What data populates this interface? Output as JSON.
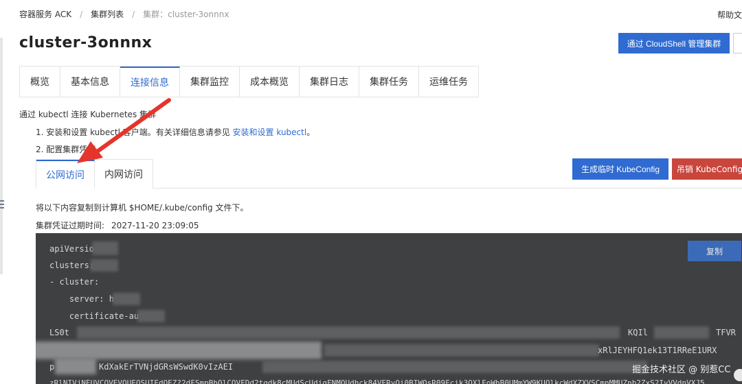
{
  "breadcrumb": [
    "容器服务 ACK",
    "集群列表",
    "集群：cluster-3onnnx"
  ],
  "help_label": "帮助文",
  "page_title": "cluster-3onnnx",
  "cloudshell_button": "通过 CloudShell 管理集群",
  "tabs": [
    "概览",
    "基本信息",
    "连接信息",
    "集群监控",
    "成本概览",
    "集群日志",
    "集群任务",
    "运维任务"
  ],
  "active_tab": "连接信息",
  "section_title": "通过 kubectl 连接 Kubernetes 集群",
  "step1_text": "1. 安装和设置 kubectl 客户端。有关详细信息请参见",
  "step1_link": "安装和设置 kubectl",
  "step1_end": "。",
  "step2_text": "2. 配置集群凭证",
  "subtabs": [
    "公网访问",
    "内网访问"
  ],
  "generate_button": "生成临时 KubeConfig",
  "revoke_button": "吊销 KubeConfig",
  "copy_hint": "将以下内容复制到计算机 $HOME/.kube/config 文件下。",
  "expire_label": "集群凭证过期时间:",
  "expire_value": "2027-11-20 23:09:05",
  "copy_button": "复制",
  "code_lines": [
    "apiVersio",
    "clusters:",
    "- cluster:",
    "    server: ht",
    "    certificate-aut",
    "LS0t",
    "xRlJEYHFQ1ek13T1RReE1URX",
    "p",
    "KdXakErTVNjdGRsWSwdK0vIzAEI",
    "zRlNIVjNEUVCOVEVQUEOSUIEdOEZ?2dFSmpBhOlCOVFDd2tgdk8cMUdScUdigFNMQUdhck84VERyOi0BIWQsR09Fcik3OXlFoWhB0UMmYW9KUOlkcWdXZXVSCmnMMUZnb2ZxS2IvVVdnVXJ5",
    "KQIl",
    "TFVR",
    "DFIZEk13T1RReE1URX"
  ],
  "watermark": "掘金技术社区 @ 别惹CC"
}
